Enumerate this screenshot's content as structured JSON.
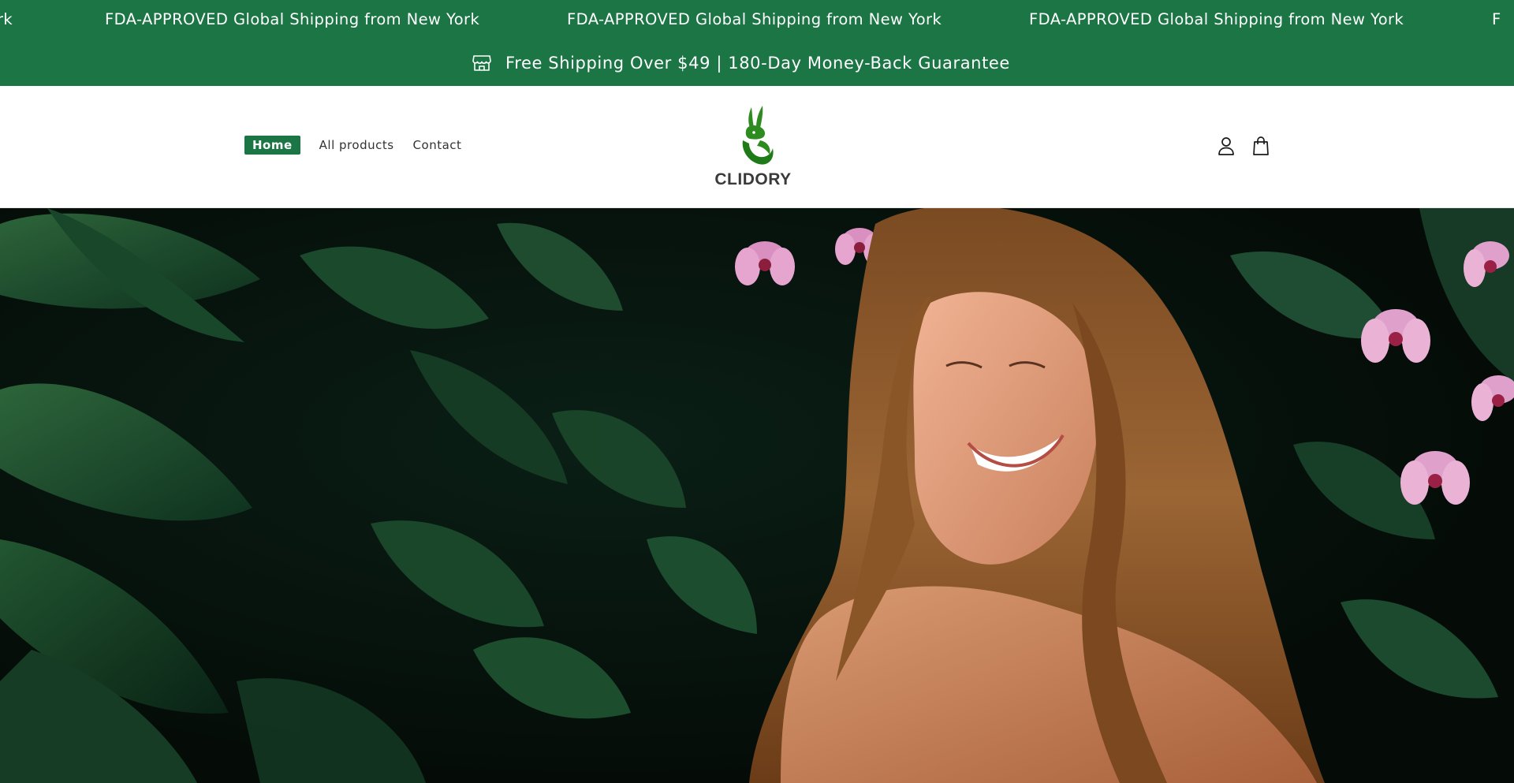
{
  "marquee": {
    "items": [
      {
        "label": "rk"
      },
      {
        "label": "FDA-APPROVED"
      },
      {
        "label": "Global Shipping from New York"
      },
      {
        "label": "FDA-APPROVED"
      },
      {
        "label": "Global Shipping from New York"
      },
      {
        "label": "FDA-APPROVED"
      },
      {
        "label": "Global Shipping from New York"
      }
    ]
  },
  "announcement": {
    "icon": "store-icon",
    "text": "Free Shipping Over $49 | 180-Day Money-Back Guarantee"
  },
  "nav": {
    "items": [
      {
        "label": "Home",
        "active": true
      },
      {
        "label": "All products",
        "active": false
      },
      {
        "label": "Contact",
        "active": false
      }
    ]
  },
  "brand": {
    "name": "CLIDORY",
    "logo_icon": "rabbit-leaf-icon"
  },
  "header_icons": {
    "account": "account-icon",
    "cart": "cart-bag-icon"
  },
  "colors": {
    "brand_green": "#1b7544",
    "logo_green": "#2e8b1f"
  }
}
